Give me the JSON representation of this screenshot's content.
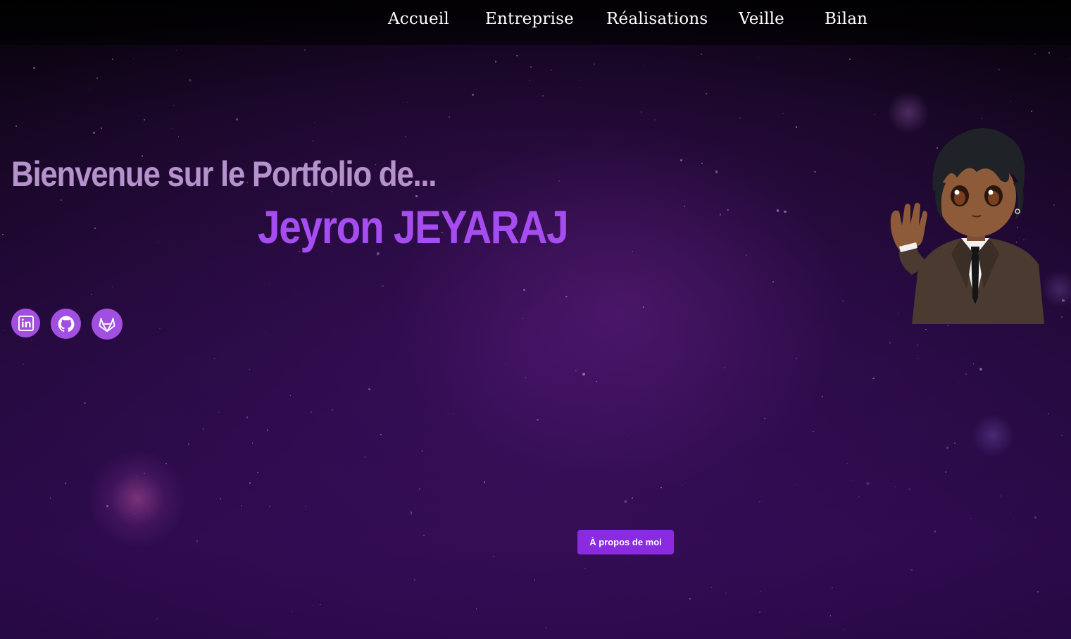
{
  "nav": {
    "items": [
      {
        "label": "Accueil"
      },
      {
        "label": "Entreprise"
      },
      {
        "label": "Réalisations"
      },
      {
        "label": "Veille"
      },
      {
        "label": "Bilan"
      }
    ]
  },
  "hero": {
    "welcome": "Bienvenue sur le Portfolio de...",
    "name": "Jeyron JEYARAJ"
  },
  "social": [
    {
      "icon": "linkedin-icon"
    },
    {
      "icon": "github-icon"
    },
    {
      "icon": "gitlab-icon"
    }
  ],
  "about_button": "À propos de moi",
  "colors": {
    "accent": "#a64df2",
    "welcome_text": "#b592cc",
    "button": "#8a2be2",
    "background": "#22093a"
  }
}
